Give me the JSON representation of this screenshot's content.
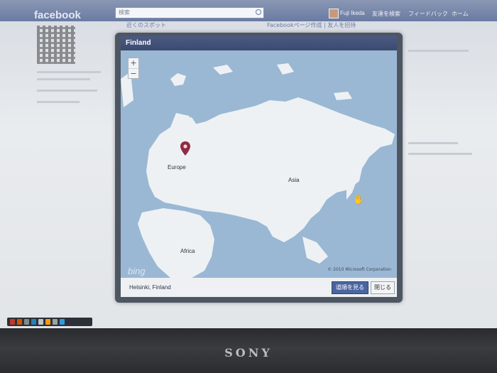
{
  "fb": {
    "logo": "facebook",
    "search_placeholder": "検索",
    "user": "Fuji Ikeda",
    "nav": [
      "友達を検索",
      "フィードバック",
      "ホーム"
    ],
    "nearby_spots": "近くのスポット",
    "sub_links": "Facebookページ作成 | 友人を招待"
  },
  "dialog": {
    "title": "Finland",
    "location": "Helsinki, Finland",
    "primary_button": "道順を見る",
    "close_button": "閉じる"
  },
  "map": {
    "labels": {
      "europe": "Europe",
      "asia": "Asia",
      "africa": "Africa"
    },
    "logo": "bing",
    "copyright": "© 2010 Microsoft Corporation",
    "zoom_in": "+",
    "zoom_out": "−",
    "pin_icon": "map-pin-icon"
  },
  "monitor": {
    "brand": "SONY"
  },
  "colors": {
    "fb_blue": "#3b5998",
    "dialog_button": "#4a66a0",
    "ocean": "#9ab8d4",
    "land": "#eef1f3"
  }
}
